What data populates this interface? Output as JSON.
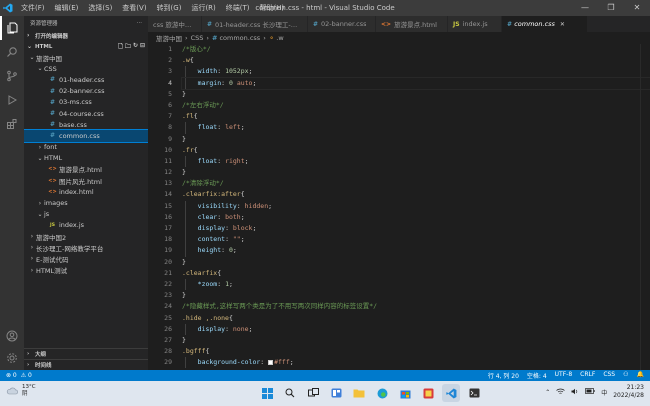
{
  "titlebar": {
    "menu": [
      "文件(F)",
      "编辑(E)",
      "选择(S)",
      "查看(V)",
      "转到(G)",
      "运行(R)",
      "终端(T)",
      "帮助(H)"
    ],
    "title": "common.css - html - Visual Studio Code",
    "controls": [
      "—",
      "❐",
      "✕"
    ]
  },
  "sidebar": {
    "header": "资源管理器",
    "header_more": "···",
    "open_editors": "打开的编辑器",
    "workspace": "HTML",
    "tree": [
      {
        "label": "旅游中国",
        "depth": 1,
        "kind": "folder",
        "open": true
      },
      {
        "label": "CSS",
        "depth": 2,
        "kind": "folder",
        "open": true
      },
      {
        "label": "01-header.css",
        "depth": 3,
        "kind": "css"
      },
      {
        "label": "02-banner.css",
        "depth": 3,
        "kind": "css"
      },
      {
        "label": "03-ms.css",
        "depth": 3,
        "kind": "css"
      },
      {
        "label": "04-course.css",
        "depth": 3,
        "kind": "css"
      },
      {
        "label": "base.css",
        "depth": 3,
        "kind": "css"
      },
      {
        "label": "common.css",
        "depth": 3,
        "kind": "css",
        "selected": true
      },
      {
        "label": "font",
        "depth": 2,
        "kind": "folder",
        "open": false
      },
      {
        "label": "HTML",
        "depth": 2,
        "kind": "folder",
        "open": true
      },
      {
        "label": "旅游景点.html",
        "depth": 3,
        "kind": "html"
      },
      {
        "label": "图片风光.html",
        "depth": 3,
        "kind": "html"
      },
      {
        "label": "index.html",
        "depth": 3,
        "kind": "html"
      },
      {
        "label": "images",
        "depth": 2,
        "kind": "folder",
        "open": false
      },
      {
        "label": "js",
        "depth": 2,
        "kind": "folder",
        "open": true
      },
      {
        "label": "index.js",
        "depth": 3,
        "kind": "js"
      },
      {
        "label": "旅游中国2",
        "depth": 1,
        "kind": "folder",
        "open": false
      },
      {
        "label": "长沙理工-网络教学平台",
        "depth": 1,
        "kind": "folder",
        "open": false
      },
      {
        "label": "E-测试代码",
        "depth": 1,
        "kind": "folder",
        "open": false
      },
      {
        "label": "HTML测试",
        "depth": 1,
        "kind": "folder",
        "open": false
      }
    ],
    "outline": "大纲",
    "timeline": "时间线"
  },
  "tabs": [
    {
      "label": "css 旅游中国\\...",
      "kind": "css"
    },
    {
      "label": "01-header.css  长沙理工-网络教学平台\\...",
      "kind": "css"
    },
    {
      "label": "02-banner.css",
      "kind": "css"
    },
    {
      "label": "旅游景点.html",
      "kind": "html"
    },
    {
      "label": "index.js",
      "kind": "js"
    },
    {
      "label": "common.css",
      "kind": "css",
      "active": true
    }
  ],
  "breadcrumbs": [
    "旅游中国",
    "CSS",
    "common.css",
    ".w"
  ],
  "editor": {
    "lines": [
      [
        [
          "c-com",
          "/*版心*/"
        ]
      ],
      [
        [
          "c-sel",
          ".w"
        ],
        [
          "c-pun",
          "{"
        ]
      ],
      [
        [
          "c-pun",
          "    "
        ],
        [
          "c-prop",
          "width"
        ],
        [
          "c-pun",
          ": "
        ],
        [
          "c-num",
          "1052px"
        ],
        [
          "c-pun",
          ";"
        ]
      ],
      [
        [
          "c-pun",
          "    "
        ],
        [
          "c-prop",
          "margin"
        ],
        [
          "c-pun",
          ": "
        ],
        [
          "c-num",
          "0"
        ],
        [
          "c-pun",
          " "
        ],
        [
          "c-val",
          "auto"
        ],
        [
          "c-pun",
          ";"
        ]
      ],
      [
        [
          "c-pun",
          "}"
        ]
      ],
      [
        [
          "c-com",
          "/*左右浮动*/"
        ]
      ],
      [
        [
          "c-sel",
          ".fl"
        ],
        [
          "c-pun",
          "{"
        ]
      ],
      [
        [
          "c-pun",
          "    "
        ],
        [
          "c-prop",
          "float"
        ],
        [
          "c-pun",
          ": "
        ],
        [
          "c-val",
          "left"
        ],
        [
          "c-pun",
          ";"
        ]
      ],
      [
        [
          "c-pun",
          "}"
        ]
      ],
      [
        [
          "c-sel",
          ".fr"
        ],
        [
          "c-pun",
          "{"
        ]
      ],
      [
        [
          "c-pun",
          "    "
        ],
        [
          "c-prop",
          "float"
        ],
        [
          "c-pun",
          ": "
        ],
        [
          "c-val",
          "right"
        ],
        [
          "c-pun",
          ";"
        ]
      ],
      [
        [
          "c-pun",
          "}"
        ]
      ],
      [
        [
          "c-com",
          "/*清除浮动*/"
        ]
      ],
      [
        [
          "c-sel",
          ".clearfix:after"
        ],
        [
          "c-pun",
          "{"
        ]
      ],
      [
        [
          "c-pun",
          "    "
        ],
        [
          "c-prop",
          "visibility"
        ],
        [
          "c-pun",
          ": "
        ],
        [
          "c-val",
          "hidden"
        ],
        [
          "c-pun",
          ";"
        ]
      ],
      [
        [
          "c-pun",
          "    "
        ],
        [
          "c-prop",
          "clear"
        ],
        [
          "c-pun",
          ": "
        ],
        [
          "c-val",
          "both"
        ],
        [
          "c-pun",
          ";"
        ]
      ],
      [
        [
          "c-pun",
          "    "
        ],
        [
          "c-prop",
          "display"
        ],
        [
          "c-pun",
          ": "
        ],
        [
          "c-val",
          "block"
        ],
        [
          "c-pun",
          ";"
        ]
      ],
      [
        [
          "c-pun",
          "    "
        ],
        [
          "c-prop",
          "content"
        ],
        [
          "c-pun",
          ": "
        ],
        [
          "c-val",
          "\"\""
        ],
        [
          "c-pun",
          ";"
        ]
      ],
      [
        [
          "c-pun",
          "    "
        ],
        [
          "c-prop",
          "height"
        ],
        [
          "c-pun",
          ": "
        ],
        [
          "c-num",
          "0"
        ],
        [
          "c-pun",
          ";"
        ]
      ],
      [
        [
          "c-pun",
          "}"
        ]
      ],
      [
        [
          "c-sel",
          ".clearfix"
        ],
        [
          "c-pun",
          "{"
        ]
      ],
      [
        [
          "c-pun",
          "    "
        ],
        [
          "c-prop",
          "*zoom"
        ],
        [
          "c-pun",
          ": "
        ],
        [
          "c-num",
          "1"
        ],
        [
          "c-pun",
          ";"
        ]
      ],
      [
        [
          "c-pun",
          "}"
        ]
      ],
      [
        [
          "c-com",
          "/*隐藏样式,这样写两个类是为了不用写两次同样内容的标签设置*/"
        ]
      ],
      [
        [
          "c-sel",
          ".hide ,.none"
        ],
        [
          "c-pun",
          "{"
        ]
      ],
      [
        [
          "c-pun",
          "    "
        ],
        [
          "c-prop",
          "display"
        ],
        [
          "c-pun",
          ": "
        ],
        [
          "c-val",
          "none"
        ],
        [
          "c-pun",
          ";"
        ]
      ],
      [
        [
          "c-pun",
          "}"
        ]
      ],
      [
        [
          "c-sel",
          ".bgfff"
        ],
        [
          "c-pun",
          "{"
        ]
      ],
      [
        [
          "c-pun",
          "    "
        ],
        [
          "c-prop",
          "background-color"
        ],
        [
          "c-pun",
          ": "
        ],
        [
          "swatch",
          ""
        ],
        [
          "c-val",
          "#fff"
        ],
        [
          "c-pun",
          ";"
        ]
      ],
      [
        [
          "c-pun",
          "}"
        ]
      ]
    ],
    "current_line": 4
  },
  "status": {
    "left": [
      "⊗ 0",
      "⚠ 0"
    ],
    "right": [
      "行 4, 列 20",
      "空格: 4",
      "UTF-8",
      "CRLF",
      "CSS",
      "⚇",
      "🔔"
    ]
  },
  "taskbar": {
    "temp": "13°C",
    "weather": "阴",
    "time": "21:23",
    "date": "2022/4/28",
    "lang": "中"
  },
  "colors": {
    "accent": "#007acc",
    "selection": "#094771"
  }
}
